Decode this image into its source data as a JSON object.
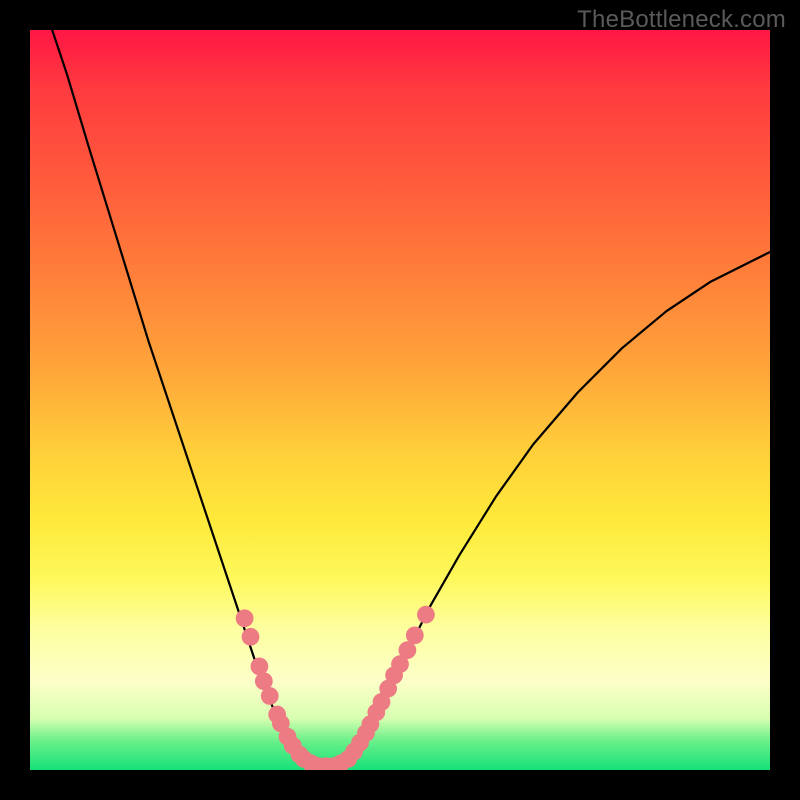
{
  "watermark": "TheBottleneck.com",
  "colors": {
    "curve_stroke": "#000000",
    "marker_fill": "#ed7b84",
    "marker_stroke": "#ed7b84"
  },
  "chart_data": {
    "type": "line",
    "title": "",
    "xlabel": "",
    "ylabel": "",
    "xlim": [
      0,
      100
    ],
    "ylim": [
      0,
      100
    ],
    "curve": [
      {
        "x": 3,
        "y": 100
      },
      {
        "x": 5,
        "y": 94
      },
      {
        "x": 8,
        "y": 84
      },
      {
        "x": 12,
        "y": 71
      },
      {
        "x": 16,
        "y": 58
      },
      {
        "x": 20,
        "y": 46
      },
      {
        "x": 24,
        "y": 34
      },
      {
        "x": 27,
        "y": 25
      },
      {
        "x": 29,
        "y": 19
      },
      {
        "x": 31,
        "y": 13
      },
      {
        "x": 33,
        "y": 8
      },
      {
        "x": 35,
        "y": 4
      },
      {
        "x": 37,
        "y": 1.5
      },
      {
        "x": 39,
        "y": 0.5
      },
      {
        "x": 41,
        "y": 0.5
      },
      {
        "x": 43,
        "y": 1.5
      },
      {
        "x": 45,
        "y": 4
      },
      {
        "x": 47,
        "y": 8
      },
      {
        "x": 50,
        "y": 14
      },
      {
        "x": 54,
        "y": 22
      },
      {
        "x": 58,
        "y": 29
      },
      {
        "x": 63,
        "y": 37
      },
      {
        "x": 68,
        "y": 44
      },
      {
        "x": 74,
        "y": 51
      },
      {
        "x": 80,
        "y": 57
      },
      {
        "x": 86,
        "y": 62
      },
      {
        "x": 92,
        "y": 66
      },
      {
        "x": 98,
        "y": 69
      },
      {
        "x": 100,
        "y": 70
      }
    ],
    "markers": [
      {
        "x": 29.0,
        "y": 20.5
      },
      {
        "x": 29.8,
        "y": 18.0
      },
      {
        "x": 31.0,
        "y": 14.0
      },
      {
        "x": 31.6,
        "y": 12.0
      },
      {
        "x": 32.4,
        "y": 10.0
      },
      {
        "x": 33.4,
        "y": 7.5
      },
      {
        "x": 33.9,
        "y": 6.3
      },
      {
        "x": 34.8,
        "y": 4.5
      },
      {
        "x": 35.5,
        "y": 3.3
      },
      {
        "x": 36.4,
        "y": 2.1
      },
      {
        "x": 37.0,
        "y": 1.5
      },
      {
        "x": 38.0,
        "y": 0.9
      },
      {
        "x": 39.0,
        "y": 0.5
      },
      {
        "x": 40.0,
        "y": 0.5
      },
      {
        "x": 41.0,
        "y": 0.5
      },
      {
        "x": 42.0,
        "y": 0.9
      },
      {
        "x": 43.0,
        "y": 1.5
      },
      {
        "x": 43.8,
        "y": 2.5
      },
      {
        "x": 44.6,
        "y": 3.7
      },
      {
        "x": 45.4,
        "y": 5.0
      },
      {
        "x": 46.0,
        "y": 6.2
      },
      {
        "x": 46.8,
        "y": 7.8
      },
      {
        "x": 47.5,
        "y": 9.2
      },
      {
        "x": 48.4,
        "y": 11.0
      },
      {
        "x": 49.2,
        "y": 12.8
      },
      {
        "x": 50.0,
        "y": 14.3
      },
      {
        "x": 51.0,
        "y": 16.2
      },
      {
        "x": 52.0,
        "y": 18.2
      },
      {
        "x": 53.5,
        "y": 21.0
      }
    ],
    "marker_radius": 1.2
  }
}
